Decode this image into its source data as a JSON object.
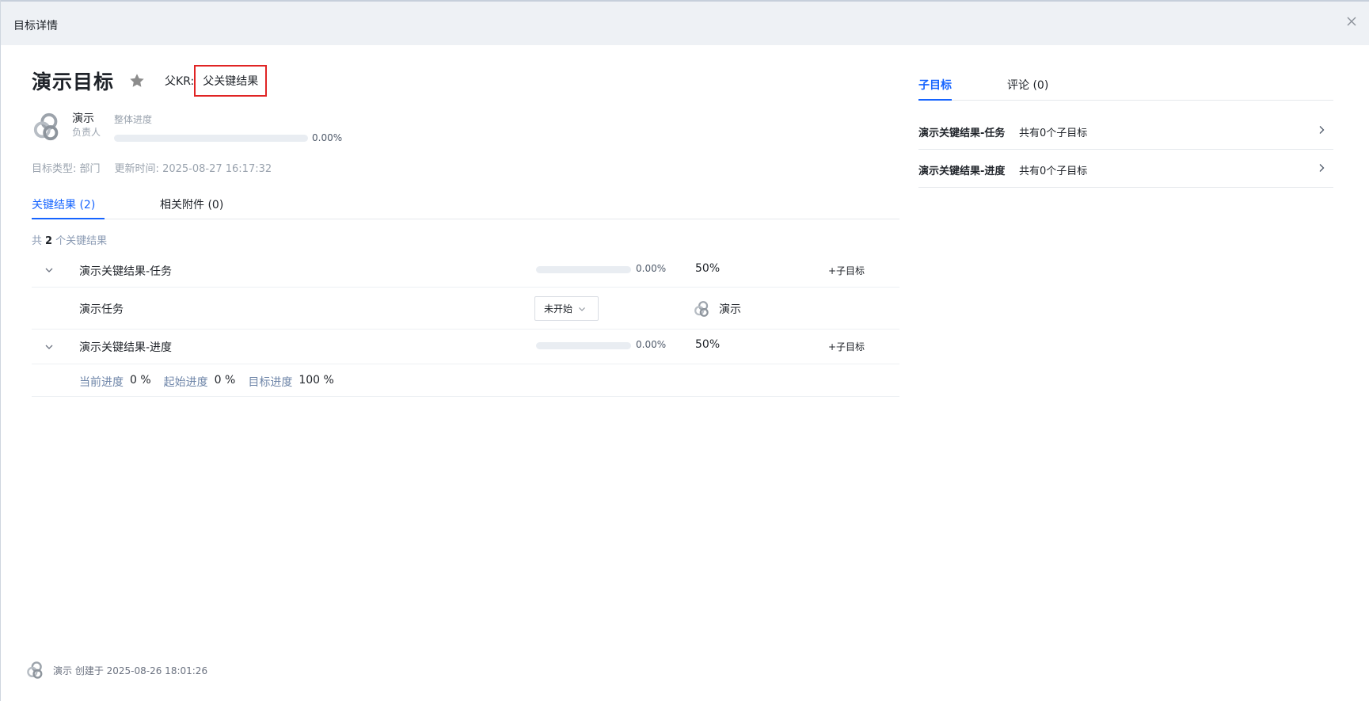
{
  "header": {
    "title": "目标详情"
  },
  "objective": {
    "title": "演示目标",
    "parent_kr_label": "父KR:",
    "parent_kr_value": "父关键结果",
    "owner_name": "演示",
    "owner_role": "负责人",
    "overall_label": "整体进度",
    "overall_progress": 0.0,
    "overall_progress_text": "0.00%",
    "type_label": "目标类型:",
    "type_value": "部门",
    "updated_label": "更新时间:",
    "updated_value": "2025-08-27 16:17:32"
  },
  "tabs": [
    {
      "label": "关键结果 (2)"
    },
    {
      "label": "相关附件 (0)"
    }
  ],
  "kr_count": {
    "prefix": "共",
    "count": "2",
    "suffix": "个关键结果"
  },
  "key_results": [
    {
      "title": "演示关键结果-任务",
      "progress": 0.0,
      "progress_text": "0.00%",
      "weight": "50%",
      "add_child": "+子目标",
      "task": {
        "title": "演示任务",
        "status": "未开始",
        "assignee": "演示"
      }
    },
    {
      "title": "演示关键结果-进度",
      "progress": 0.0,
      "progress_text": "0.00%",
      "weight": "50%",
      "add_child": "+子目标",
      "detail": {
        "current_label": "当前进度",
        "current_value": "0 %",
        "start_label": "起始进度",
        "start_value": "0 %",
        "target_label": "目标进度",
        "target_value": "100 %"
      }
    }
  ],
  "right_tabs": [
    {
      "label": "子目标"
    },
    {
      "label": "评论 (0)"
    }
  ],
  "child_objectives": [
    {
      "title": "演示关键结果-任务",
      "count_text": "共有0个子目标"
    },
    {
      "title": "演示关键结果-进度",
      "count_text": "共有0个子目标"
    }
  ],
  "footer": {
    "text": "演示 创建于 2025-08-26 18:01:26"
  },
  "colors": {
    "accent": "#1664ff",
    "highlight_border": "#e02424"
  },
  "icons": [
    "close-icon",
    "star-icon",
    "avatar-logo-icon",
    "chevron-down-icon",
    "chevron-right-icon"
  ]
}
